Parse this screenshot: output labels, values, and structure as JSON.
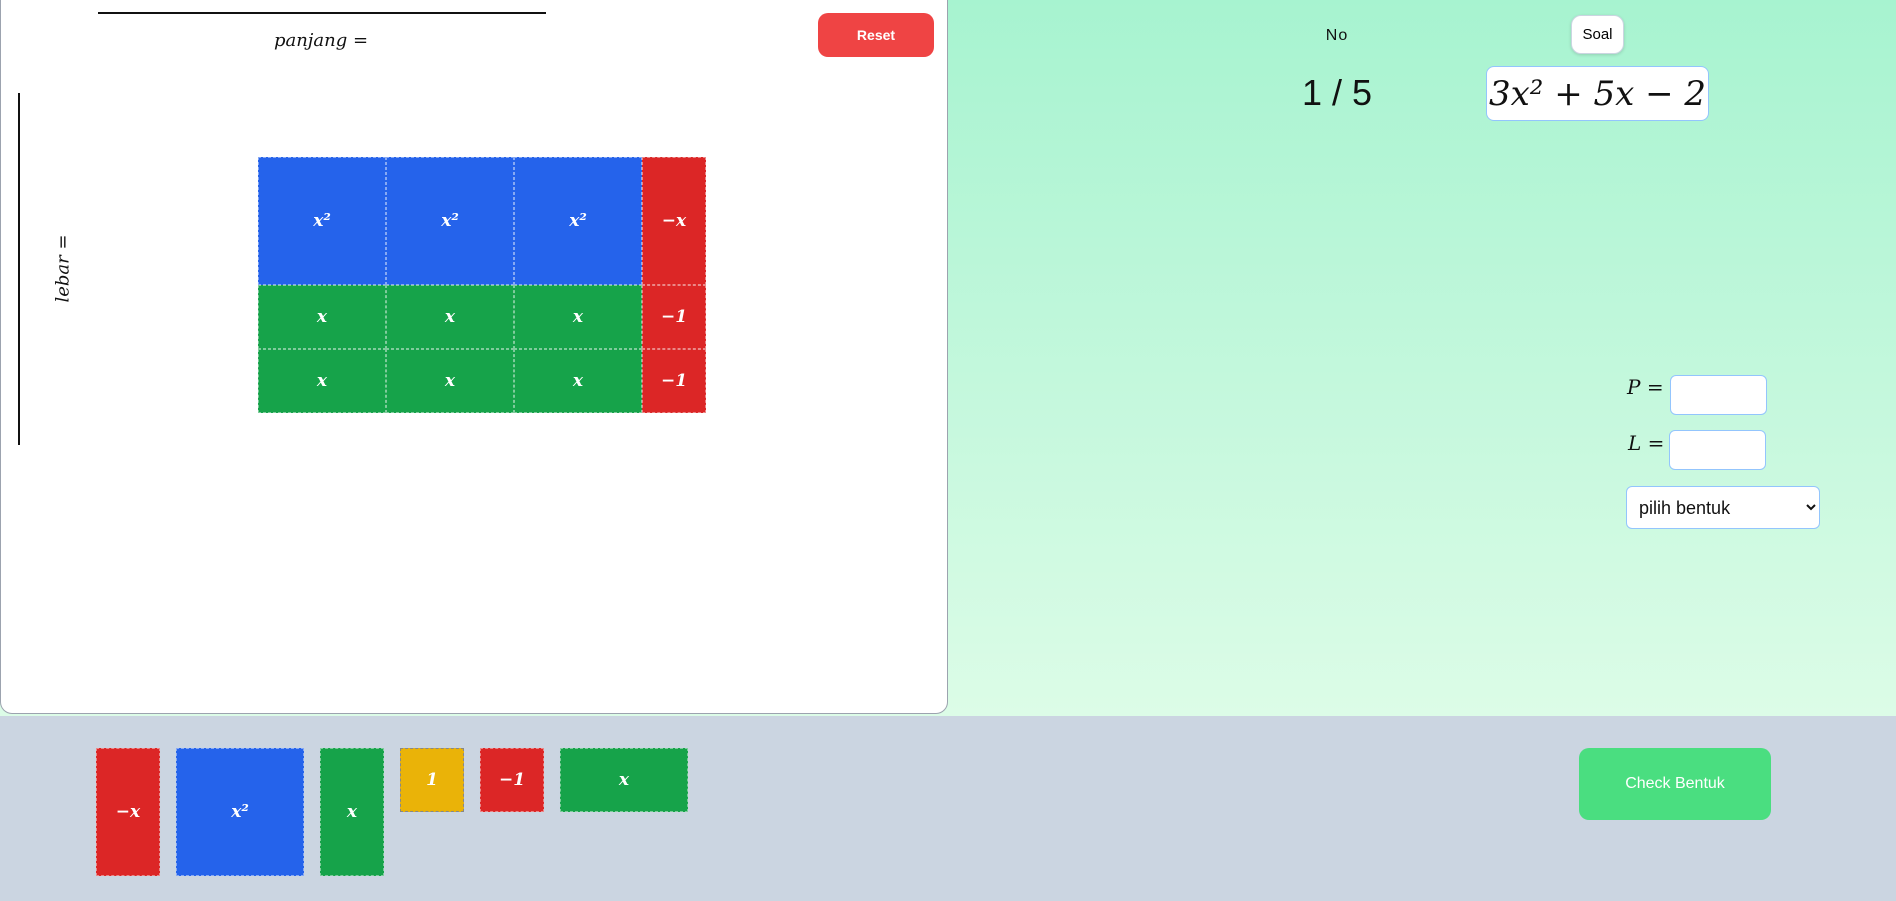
{
  "workspace": {
    "length_label": "panjang =",
    "width_label": "lebar =",
    "reset_label": "Reset",
    "grid": {
      "rows": [
        [
          "x²",
          "x²",
          "x²",
          "−x"
        ],
        [
          "x",
          "x",
          "x",
          "−1"
        ],
        [
          "x",
          "x",
          "x",
          "−1"
        ]
      ]
    }
  },
  "header": {
    "no_label": "No",
    "counter": "1 / 5",
    "soal_label": "Soal",
    "expression": "3x² + 5x − 2"
  },
  "answer": {
    "p_label": "P =",
    "l_label": "L =",
    "p_value": "",
    "l_value": "",
    "shape_selected": "pilih bentuk"
  },
  "palette": {
    "tiles": [
      "−x",
      "x²",
      "x",
      "1",
      "−1",
      "x"
    ]
  },
  "check_label": "Check Bentuk",
  "colors": {
    "x_squared_tile": "#2563eb",
    "x_tile": "#16a34a",
    "negative_tile": "#dc2626",
    "unit_tile": "#eab308",
    "reset": "#ef4444",
    "check": "#4ade80"
  }
}
